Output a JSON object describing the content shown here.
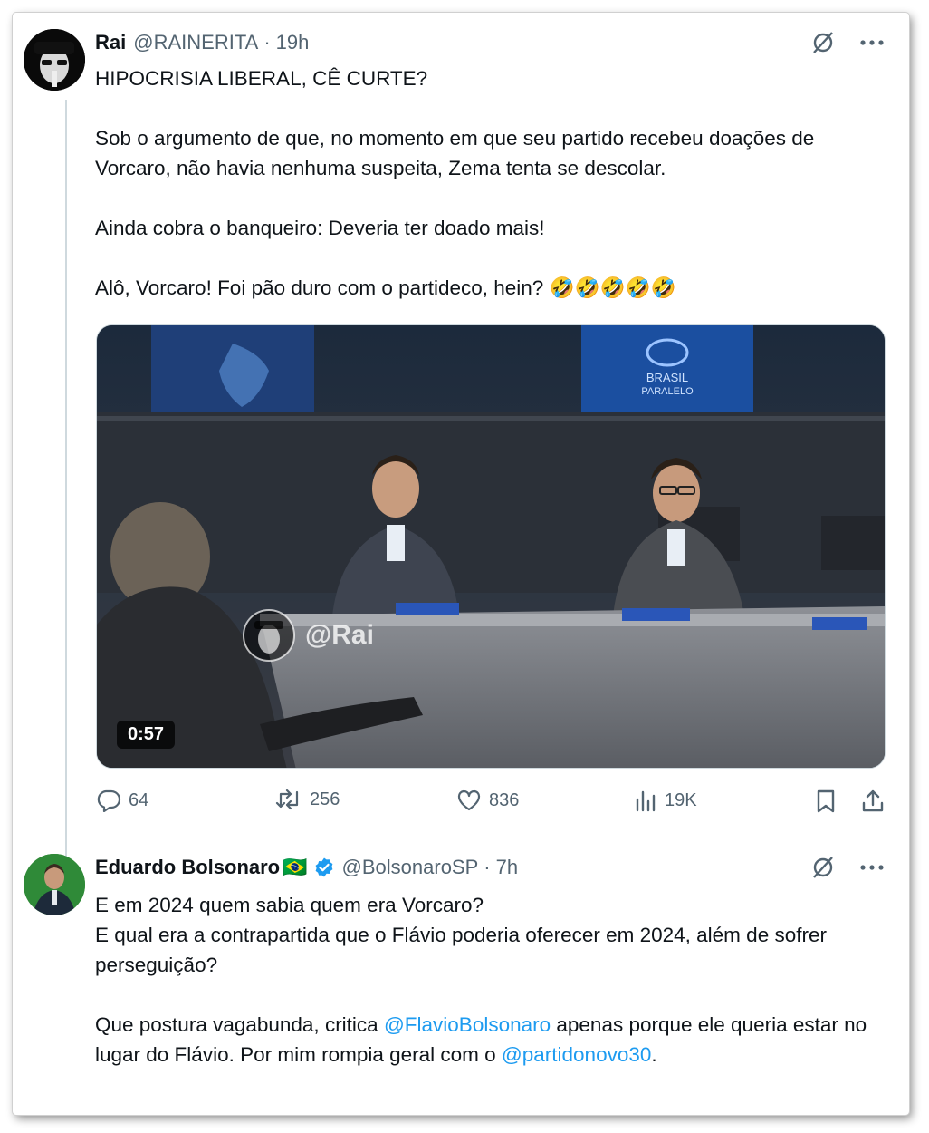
{
  "tweet1": {
    "name": "Rai",
    "handle": "@RAINERITA",
    "time": "19h",
    "paragraphs": [
      "HIPOCRISIA LIBERAL, CÊ CURTE?",
      "Sob o argumento de que, no momento em que seu partido recebeu doações de Vorcaro, não havia nenhuma suspeita, Zema tenta se descolar.",
      "Ainda cobra o banqueiro: Deveria ter doado mais!",
      "Alô, Vorcaro! Foi pão duro com o partideco, hein? 🤣🤣🤣🤣🤣"
    ],
    "video": {
      "duration": "0:57",
      "watermark": "@Rai",
      "screen_text_line1": "BRASIL",
      "screen_text_line2": "PARALELO"
    },
    "actions": {
      "replies": "64",
      "reposts": "256",
      "likes": "836",
      "views": "19K"
    }
  },
  "tweet2": {
    "name": "Eduardo Bolsonaro",
    "flag": "🇧🇷",
    "handle": "@BolsonaroSP",
    "time": "7h",
    "line1": "E em 2024 quem sabia quem era Vorcaro?",
    "line2": "E qual era a contrapartida que o Flávio poderia oferecer em 2024, além de sofrer perseguição?",
    "p2_part1": "Que postura vagabunda, critica ",
    "p2_mention1": "@FlavioBolsonaro",
    "p2_part2": " apenas porque ele queria estar no lugar do Flávio. Por mim rompia geral com o ",
    "p2_mention2": "@partidonovo30",
    "p2_part3": "."
  },
  "separator": "·",
  "colors": {
    "link": "#1d9bf0",
    "muted": "#536471",
    "verified": "#1d9bf0"
  }
}
